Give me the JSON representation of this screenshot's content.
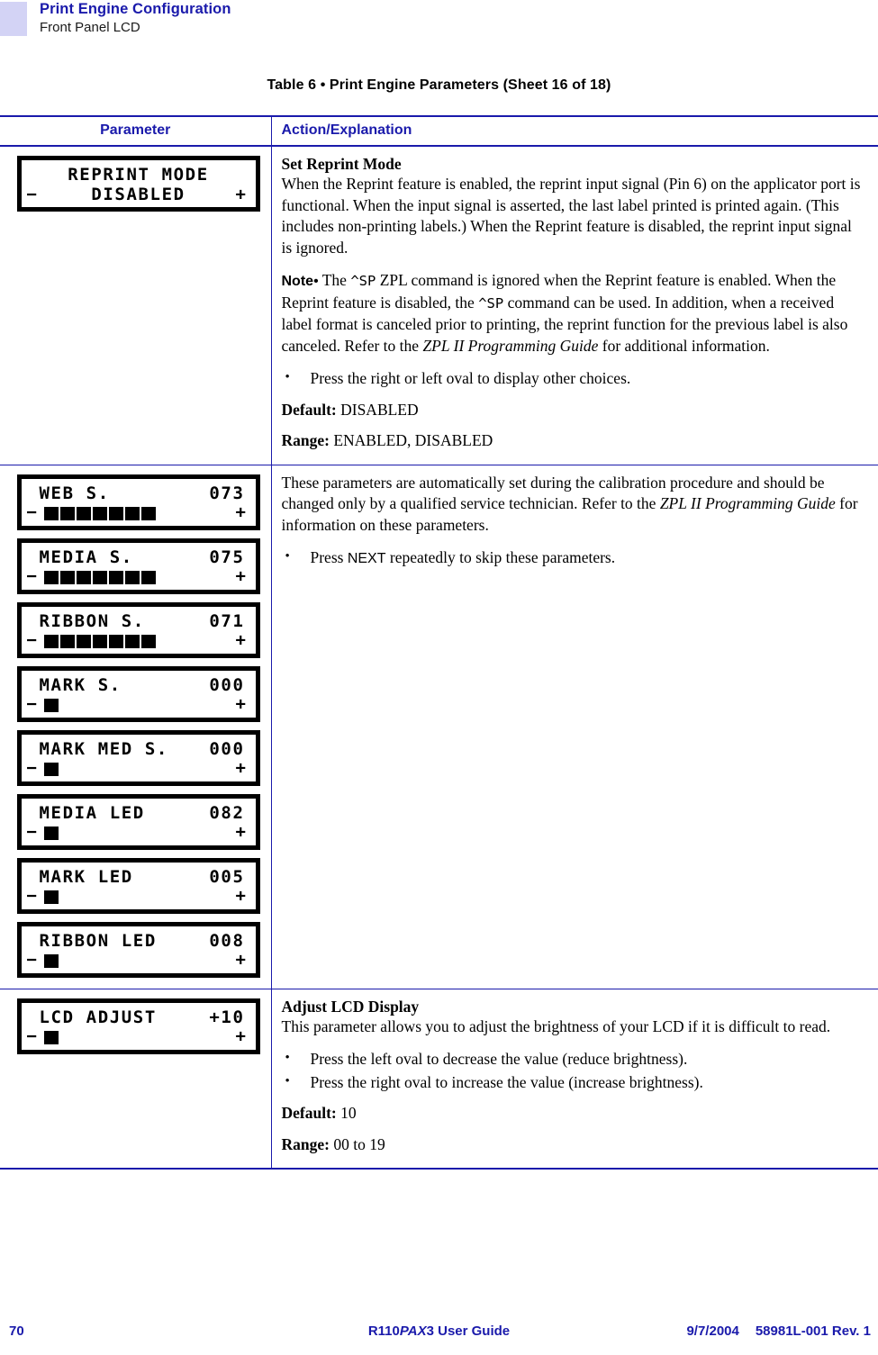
{
  "header": {
    "title": "Print Engine Configuration",
    "subtitle": "Front Panel LCD"
  },
  "table_caption": "Table 6 • Print Engine Parameters (Sheet 16 of 18)",
  "columns": {
    "parameter": "Parameter",
    "action": "Action/Explanation"
  },
  "rows": [
    {
      "lcds": [
        {
          "line1": "REPRINT MODE",
          "line1_label": "",
          "line1_value": "",
          "line2_center": "DISABLED",
          "minus": "−",
          "plus": "+",
          "bar_blocks": 0
        }
      ],
      "heading": "Set Reprint Mode",
      "paragraph1": "When the Reprint feature is enabled, the reprint input signal (Pin 6) on the applicator port is functional. When the input signal is asserted, the last label printed is printed again. (This includes non-printing labels.) When the Reprint feature is disabled, the reprint input signal is ignored.",
      "note": {
        "label": "Note",
        "bullet": "•",
        "t1": "The ",
        "cmd1": "^SP",
        "t2": " ZPL command is ignored when the Reprint feature is enabled. When the Reprint feature is disabled, the ",
        "cmd2": "^SP",
        "t3": " command can be used. In addition, when a received label format is canceled prior to printing, the reprint function for the previous label is also canceled. Refer to the ",
        "guide": "ZPL II Programming Guide",
        "t4": " for additional information."
      },
      "bullets": [
        "Press the right or left oval to display other choices."
      ],
      "default_label": "Default:",
      "default_value": "DISABLED",
      "range_label": "Range:",
      "range_value": "ENABLED, DISABLED"
    },
    {
      "lcds": [
        {
          "line1_label": "WEB S.",
          "line1_value": "073",
          "minus": "−",
          "plus": "+",
          "bar_blocks": 7
        },
        {
          "line1_label": "MEDIA S.",
          "line1_value": "075",
          "minus": "−",
          "plus": "+",
          "bar_blocks": 7
        },
        {
          "line1_label": "RIBBON S.",
          "line1_value": "071",
          "minus": "−",
          "plus": "+",
          "bar_blocks": 7
        },
        {
          "line1_label": "MARK S.",
          "line1_value": "000",
          "minus": "−",
          "plus": "+",
          "bar_blocks": 1
        },
        {
          "line1_label": "MARK MED S.",
          "line1_value": "000",
          "minus": "−",
          "plus": "+",
          "bar_blocks": 1
        },
        {
          "line1_label": "MEDIA LED",
          "line1_value": "082",
          "minus": "−",
          "plus": "+",
          "bar_blocks": 1
        },
        {
          "line1_label": "MARK LED",
          "line1_value": "005",
          "minus": "−",
          "plus": "+",
          "bar_blocks": 1
        },
        {
          "line1_label": "RIBBON LED",
          "line1_value": "008",
          "minus": "−",
          "plus": "+",
          "bar_blocks": 1
        }
      ],
      "paragraph_a": "These parameters are automatically set during the calibration procedure and should be changed only by a qualified service technician. Refer to the ",
      "guide": "ZPL II Programming Guide",
      "paragraph_b": " for information on these parameters.",
      "bullet_pre": "Press ",
      "bullet_key": "NEXT",
      "bullet_post": " repeatedly to skip these parameters."
    },
    {
      "lcds": [
        {
          "line1_label": "LCD ADJUST",
          "line1_value": "+10",
          "minus": "−",
          "plus": "+",
          "bar_blocks": 1
        }
      ],
      "heading": "Adjust LCD Display",
      "paragraph1": "This parameter allows you to adjust the brightness of your LCD if it is difficult to read.",
      "bullets": [
        "Press the left oval to decrease the value (reduce brightness).",
        "Press the right oval to increase the value (increase brightness)."
      ],
      "default_label": "Default:",
      "default_value": "10",
      "range_label": "Range:",
      "range_value": "00 to 19"
    }
  ],
  "footer": {
    "page_number": "70",
    "doc_pre": "R110",
    "doc_ital": "PAX",
    "doc_post": "3 User Guide",
    "date": "9/7/2004",
    "part_number": "58981L-001 Rev. 1"
  },
  "colors": {
    "accent_blue": "#1a1aab",
    "header_tab": "#d3d3f5",
    "lcd_border": "#000000"
  }
}
